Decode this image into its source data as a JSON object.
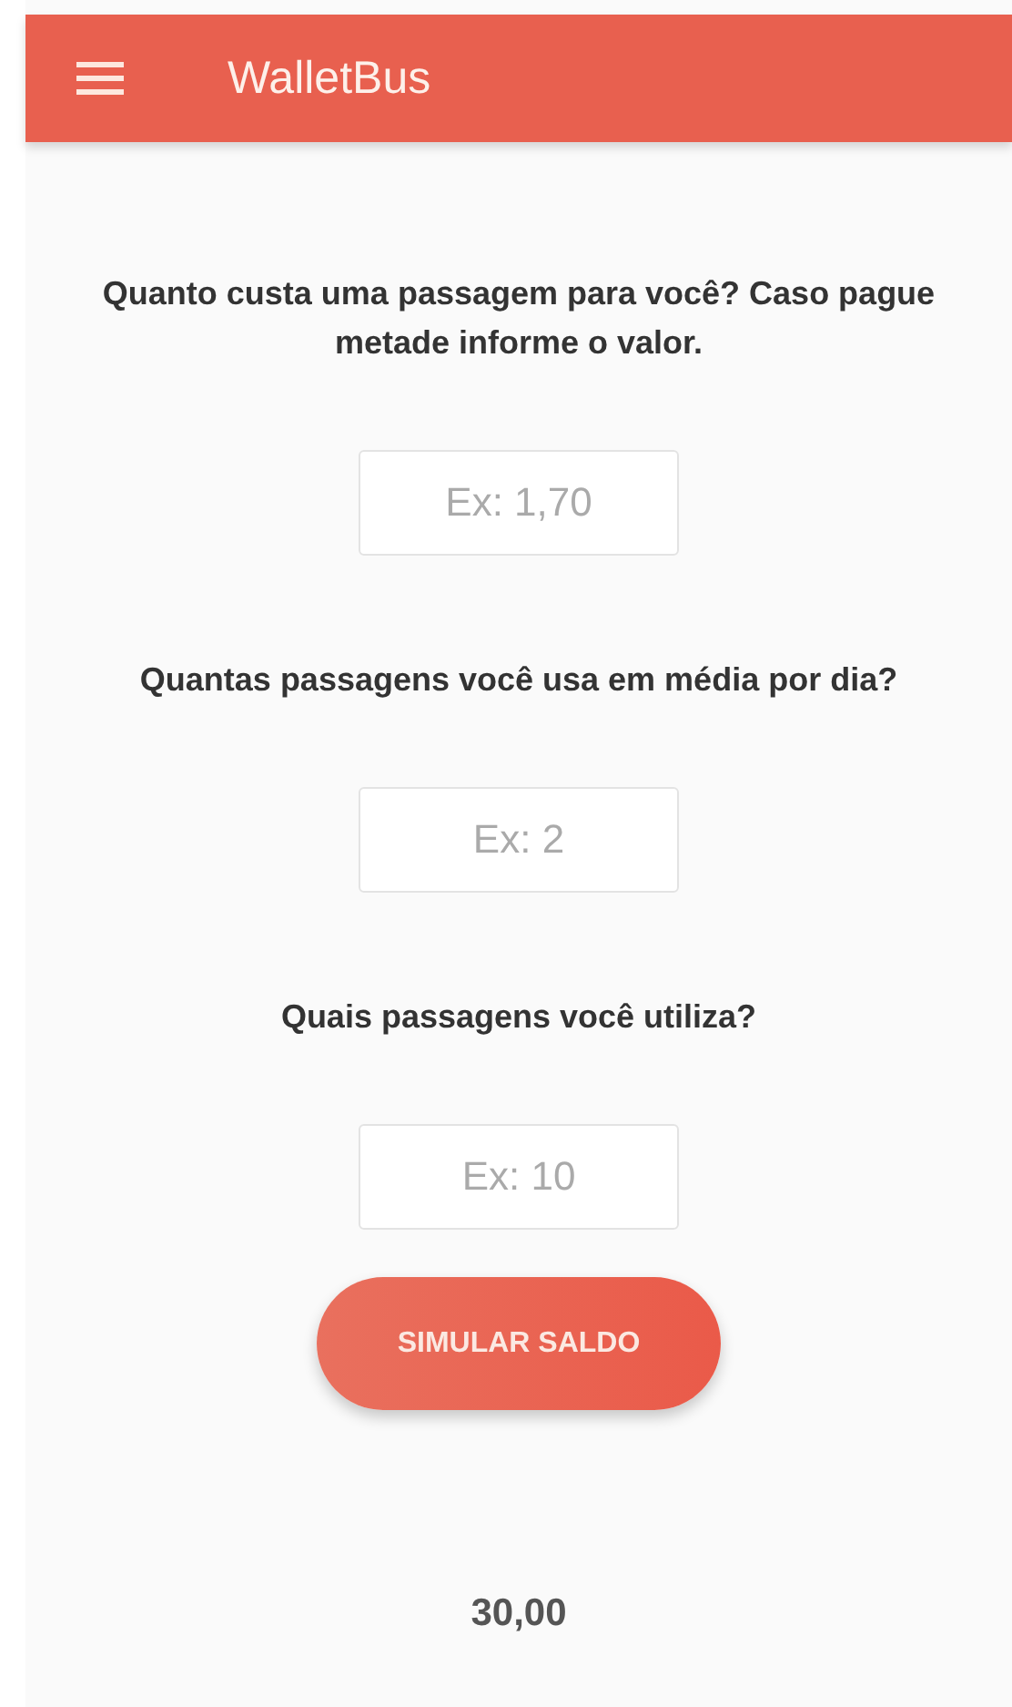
{
  "app_bar": {
    "title": "WalletBus"
  },
  "questions": [
    {
      "label": "Quanto custa uma passagem para você? Caso pague metade informe o valor.",
      "placeholder": "Ex: 1,70"
    },
    {
      "label": "Quantas passagens você usa em média por dia?",
      "placeholder": "Ex: 2"
    },
    {
      "label": "Quais passagens você utiliza?",
      "placeholder": "Ex: 10"
    }
  ],
  "button": "SIMULAR SALDO",
  "result": "30,00"
}
